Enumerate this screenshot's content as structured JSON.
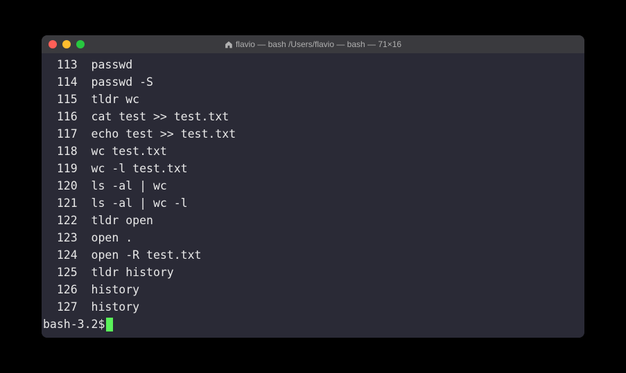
{
  "window": {
    "title": "flavio — bash /Users/flavio — bash — 71×16"
  },
  "history": [
    {
      "num": "113",
      "cmd": "passwd"
    },
    {
      "num": "114",
      "cmd": "passwd -S"
    },
    {
      "num": "115",
      "cmd": "tldr wc"
    },
    {
      "num": "116",
      "cmd": "cat test >> test.txt"
    },
    {
      "num": "117",
      "cmd": "echo test >> test.txt"
    },
    {
      "num": "118",
      "cmd": "wc test.txt"
    },
    {
      "num": "119",
      "cmd": "wc -l test.txt"
    },
    {
      "num": "120",
      "cmd": "ls -al | wc"
    },
    {
      "num": "121",
      "cmd": "ls -al | wc -l"
    },
    {
      "num": "122",
      "cmd": "tldr open"
    },
    {
      "num": "123",
      "cmd": "open ."
    },
    {
      "num": "124",
      "cmd": "open -R test.txt"
    },
    {
      "num": "125",
      "cmd": "tldr history"
    },
    {
      "num": "126",
      "cmd": "history"
    },
    {
      "num": "127",
      "cmd": "history"
    }
  ],
  "prompt": "bash-3.2$ "
}
